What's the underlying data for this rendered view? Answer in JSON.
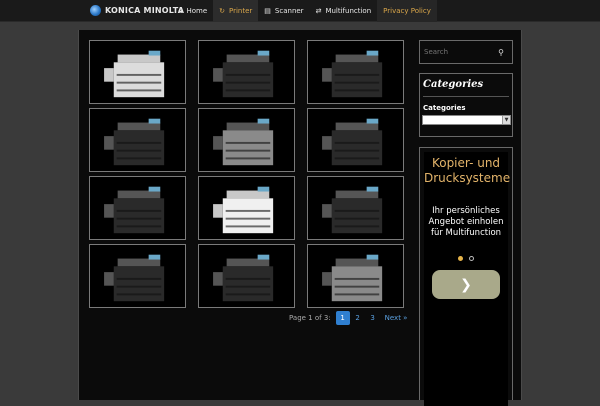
{
  "header": {
    "logo": "KONICA MINOLTA",
    "nav": [
      {
        "label": "Home",
        "icon": "home-icon"
      },
      {
        "label": "Printer",
        "icon": "refresh-icon"
      },
      {
        "label": "Scanner",
        "icon": "scanner-icon"
      },
      {
        "label": "Multifunction",
        "icon": "swap-icon"
      },
      {
        "label": "Privacy Policy",
        "icon": ""
      }
    ],
    "active_index": 1
  },
  "gallery": {
    "items": [
      {
        "alt": "printer-1"
      },
      {
        "alt": "printer-2"
      },
      {
        "alt": "printer-3"
      },
      {
        "alt": "printer-4"
      },
      {
        "alt": "printer-5"
      },
      {
        "alt": "printer-6"
      },
      {
        "alt": "printer-7"
      },
      {
        "alt": "printer-8"
      },
      {
        "alt": "printer-9"
      },
      {
        "alt": "printer-10"
      },
      {
        "alt": "printer-11"
      },
      {
        "alt": "printer-12"
      }
    ]
  },
  "pagination": {
    "label": "Page 1 of 3:",
    "pages": [
      "1",
      "2",
      "3"
    ],
    "current": "1",
    "next": "Next »"
  },
  "sidebar": {
    "search_placeholder": "Search",
    "categories_title": "Categories",
    "categories_label": "Categories",
    "ad_headline": "Kopier- und Drucksysteme",
    "ad_sub": "Ihr persönliches Angebot einholen für Multifunction"
  },
  "colors": {
    "accent": "#d9a64a",
    "link": "#5aa0e0",
    "current_page_bg": "#2f7fd0",
    "ad_button": "#a9a98a"
  }
}
